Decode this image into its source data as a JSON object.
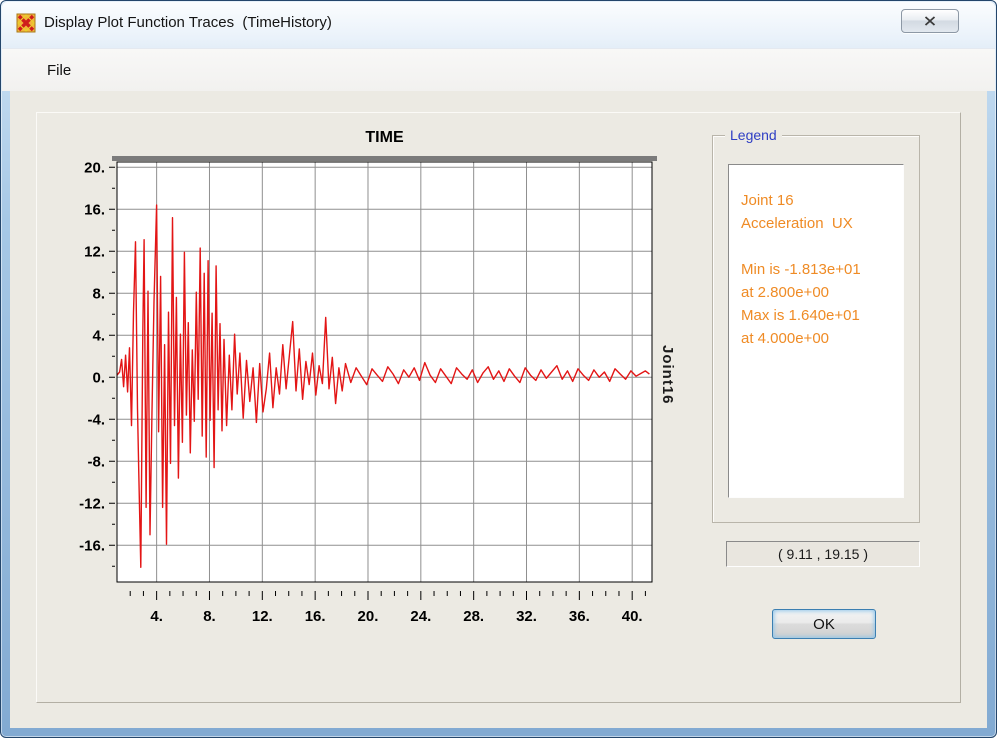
{
  "window": {
    "title": "Display Plot Function Traces  (TimeHistory)"
  },
  "menu": {
    "file_label": "File"
  },
  "legend": {
    "title": "Legend",
    "lines": [
      "Joint 16",
      "Acceleration  UX",
      "",
      "Min is -1.813e+01",
      "at 2.800e+00",
      "Max is 1.640e+01",
      "at 4.000e+00"
    ]
  },
  "readout": {
    "value": "( 9.11 , 19.15 )"
  },
  "buttons": {
    "ok": "OK"
  },
  "icons": {
    "app": "sap2000-logo",
    "close": "close-x"
  },
  "colors": {
    "trace": "#e31515",
    "grid": "#8f8f8f",
    "legend_text": "#ef8b25",
    "legend_title": "#2e3ec4",
    "plot_top_bar": "#7b7b7b"
  },
  "chart_data": {
    "type": "line",
    "title": "TIME",
    "right_label": "Joint16",
    "xlabel": "TIME",
    "ylabel": "Joint16",
    "xlim": [
      1.0,
      41.5
    ],
    "ylim": [
      -19.5,
      20.5
    ],
    "grid": true,
    "x_ticks": [
      4,
      8,
      12,
      16,
      20,
      24,
      28,
      32,
      36,
      40
    ],
    "x_tick_labels": [
      "4.",
      "8.",
      "12.",
      "16.",
      "20.",
      "24.",
      "28.",
      "32.",
      "36.",
      "40."
    ],
    "y_ticks": [
      20,
      16,
      12,
      8,
      4,
      0,
      -4,
      -8,
      -12,
      -16
    ],
    "y_tick_labels": [
      "20.",
      "16.",
      "12.",
      "8.",
      "4.",
      "0.",
      "-4.",
      "-8.",
      "-12.",
      "-16."
    ],
    "annotations": {
      "min_value": -18.13,
      "min_at": 2.8,
      "max_value": 16.4,
      "max_at": 4.0
    },
    "series": [
      {
        "name": "Joint 16 Acceleration UX",
        "color": "#e31515",
        "points": [
          [
            1.0,
            0.2
          ],
          [
            1.2,
            0.5
          ],
          [
            1.35,
            1.7
          ],
          [
            1.5,
            -0.9
          ],
          [
            1.65,
            2.1
          ],
          [
            1.8,
            -1.4
          ],
          [
            1.95,
            2.8
          ],
          [
            2.1,
            -4.6
          ],
          [
            2.25,
            6.2
          ],
          [
            2.4,
            12.9
          ],
          [
            2.55,
            -3.0
          ],
          [
            2.65,
            -9.2
          ],
          [
            2.8,
            -18.1
          ],
          [
            2.95,
            4.2
          ],
          [
            3.05,
            13.1
          ],
          [
            3.2,
            -12.4
          ],
          [
            3.35,
            8.2
          ],
          [
            3.5,
            -15.0
          ],
          [
            3.65,
            -3.2
          ],
          [
            3.8,
            7.2
          ],
          [
            4.0,
            16.4
          ],
          [
            4.15,
            -5.2
          ],
          [
            4.3,
            9.6
          ],
          [
            4.45,
            -12.4
          ],
          [
            4.6,
            3.1
          ],
          [
            4.75,
            -15.9
          ],
          [
            4.9,
            6.2
          ],
          [
            5.05,
            -8.2
          ],
          [
            5.2,
            15.2
          ],
          [
            5.35,
            -4.6
          ],
          [
            5.5,
            7.6
          ],
          [
            5.65,
            -9.6
          ],
          [
            5.8,
            4.1
          ],
          [
            5.95,
            -6.2
          ],
          [
            6.1,
            11.9
          ],
          [
            6.25,
            -3.6
          ],
          [
            6.4,
            5.2
          ],
          [
            6.55,
            -7.2
          ],
          [
            6.7,
            2.6
          ],
          [
            6.85,
            -4.2
          ],
          [
            7.0,
            8.1
          ],
          [
            7.15,
            -2.1
          ],
          [
            7.3,
            12.3
          ],
          [
            7.45,
            -5.6
          ],
          [
            7.6,
            9.9
          ],
          [
            7.75,
            -7.6
          ],
          [
            7.9,
            11.1
          ],
          [
            8.05,
            -4.1
          ],
          [
            8.2,
            6.1
          ],
          [
            8.35,
            -8.6
          ],
          [
            8.5,
            10.6
          ],
          [
            8.65,
            -3.1
          ],
          [
            8.8,
            5.1
          ],
          [
            8.95,
            -5.1
          ],
          [
            9.1,
            3.6
          ],
          [
            9.3,
            -4.6
          ],
          [
            9.5,
            2.1
          ],
          [
            9.7,
            -3.1
          ],
          [
            9.9,
            4.1
          ],
          [
            10.1,
            -1.6
          ],
          [
            10.3,
            2.3
          ],
          [
            10.55,
            -3.9
          ],
          [
            10.8,
            1.6
          ],
          [
            11.05,
            -2.3
          ],
          [
            11.3,
            0.9
          ],
          [
            11.55,
            -4.3
          ],
          [
            11.8,
            1.3
          ],
          [
            12.05,
            -3.3
          ],
          [
            12.3,
            -1.1
          ],
          [
            12.55,
            2.3
          ],
          [
            12.8,
            -2.9
          ],
          [
            13.05,
            0.9
          ],
          [
            13.3,
            -1.6
          ],
          [
            13.55,
            3.1
          ],
          [
            13.8,
            -1.1
          ],
          [
            14.05,
            2.1
          ],
          [
            14.3,
            5.3
          ],
          [
            14.55,
            -1.3
          ],
          [
            14.8,
            2.7
          ],
          [
            15.05,
            -2.1
          ],
          [
            15.3,
            1.5
          ],
          [
            15.55,
            -0.7
          ],
          [
            15.8,
            2.3
          ],
          [
            16.05,
            -1.7
          ],
          [
            16.3,
            1.1
          ],
          [
            16.55,
            -0.6
          ],
          [
            16.8,
            5.7
          ],
          [
            17.05,
            -1.1
          ],
          [
            17.3,
            1.9
          ],
          [
            17.55,
            -2.5
          ],
          [
            17.8,
            0.9
          ],
          [
            18.05,
            -1.3
          ],
          [
            18.3,
            1.3
          ],
          [
            18.7,
            -0.5
          ],
          [
            19.1,
            0.9
          ],
          [
            19.5,
            0.1
          ],
          [
            19.9,
            -0.7
          ],
          [
            20.3,
            0.8
          ],
          [
            20.7,
            0.2
          ],
          [
            21.1,
            -0.4
          ],
          [
            21.5,
            1.0
          ],
          [
            21.9,
            0.3
          ],
          [
            22.3,
            -0.6
          ],
          [
            22.7,
            0.7
          ],
          [
            23.1,
            0.0
          ],
          [
            23.5,
            0.9
          ],
          [
            23.9,
            -0.3
          ],
          [
            24.3,
            1.4
          ],
          [
            24.7,
            0.2
          ],
          [
            25.1,
            -0.5
          ],
          [
            25.5,
            0.8
          ],
          [
            25.9,
            0.1
          ],
          [
            26.3,
            -0.6
          ],
          [
            26.7,
            0.9
          ],
          [
            27.1,
            0.3
          ],
          [
            27.5,
            -0.2
          ],
          [
            27.9,
            0.7
          ],
          [
            28.3,
            -0.5
          ],
          [
            28.7,
            0.4
          ],
          [
            29.1,
            1.0
          ],
          [
            29.5,
            -0.2
          ],
          [
            29.9,
            0.6
          ],
          [
            30.3,
            -0.4
          ],
          [
            30.7,
            0.8
          ],
          [
            31.1,
            0.1
          ],
          [
            31.5,
            -0.5
          ],
          [
            31.9,
            0.9
          ],
          [
            32.3,
            0.2
          ],
          [
            32.7,
            -0.3
          ],
          [
            33.1,
            0.7
          ],
          [
            33.5,
            -0.1
          ],
          [
            33.9,
            0.5
          ],
          [
            34.3,
            1.1
          ],
          [
            34.7,
            -0.2
          ],
          [
            35.1,
            0.6
          ],
          [
            35.5,
            -0.4
          ],
          [
            35.9,
            0.8
          ],
          [
            36.3,
            0.2
          ],
          [
            36.7,
            -0.3
          ],
          [
            37.1,
            0.7
          ],
          [
            37.5,
            0.0
          ],
          [
            37.9,
            0.5
          ],
          [
            38.3,
            -0.4
          ],
          [
            38.7,
            0.8
          ],
          [
            39.1,
            0.3
          ],
          [
            39.5,
            -0.2
          ],
          [
            39.9,
            0.6
          ],
          [
            40.3,
            0.1
          ],
          [
            40.7,
            0.4
          ],
          [
            41.0,
            0.6
          ],
          [
            41.3,
            0.3
          ]
        ]
      }
    ]
  }
}
